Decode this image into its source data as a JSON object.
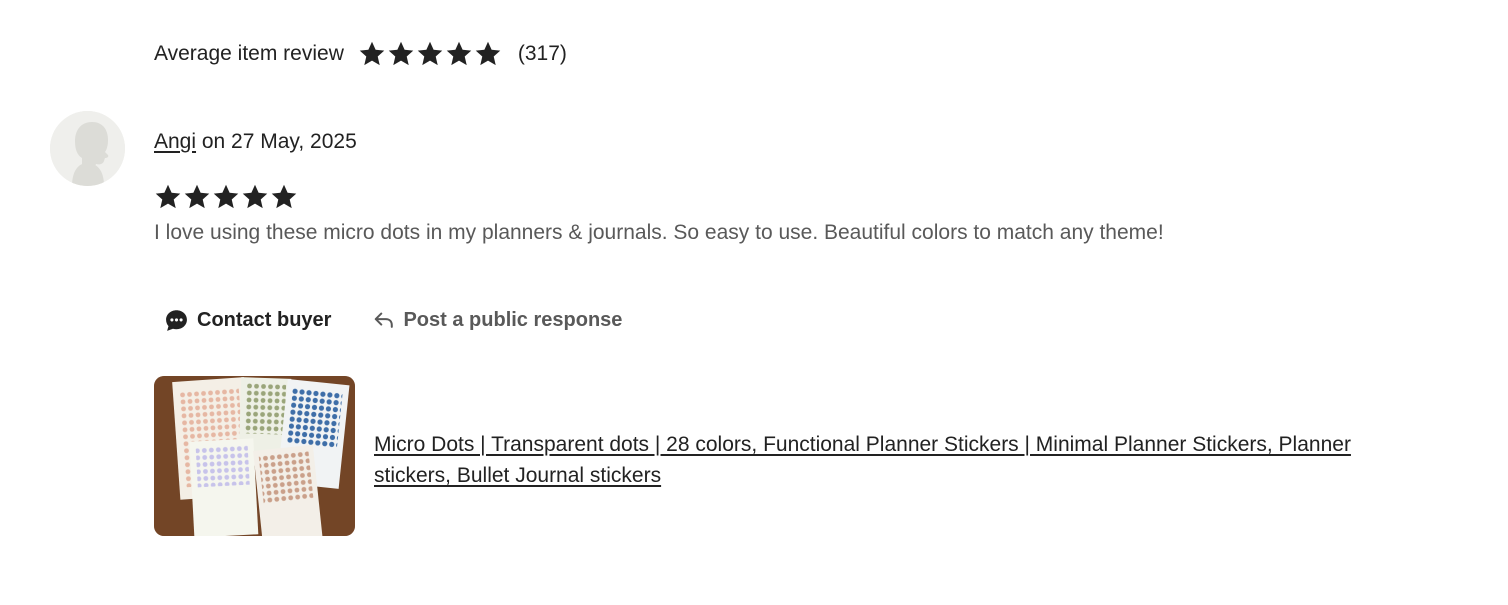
{
  "summary": {
    "label": "Average item review",
    "rating": 5,
    "count": "(317)"
  },
  "review": {
    "reviewer_name": "Angi",
    "date_text": " on 27 May, 2025",
    "rating": 5,
    "text": "I love using these micro dots in my planners & journals. So easy to use. Beautiful colors to match any theme!",
    "avatar_icon": "default-avatar-silhouette"
  },
  "actions": {
    "contact_label": "Contact buyer",
    "contact_icon": "chat-bubble-icon",
    "public_label": "Post a public response",
    "public_icon": "reply-arrow-icon"
  },
  "listing": {
    "title": "Micro Dots | Transparent dots | 28 colors, Functional Planner Stickers | Minimal Planner Stickers, Planner stickers, Bullet Journal stickers",
    "thumbnail": "micro-dot-sticker-sheets-photo"
  },
  "colors": {
    "text_primary": "#222222",
    "text_secondary": "#595959",
    "star": "#222222"
  }
}
